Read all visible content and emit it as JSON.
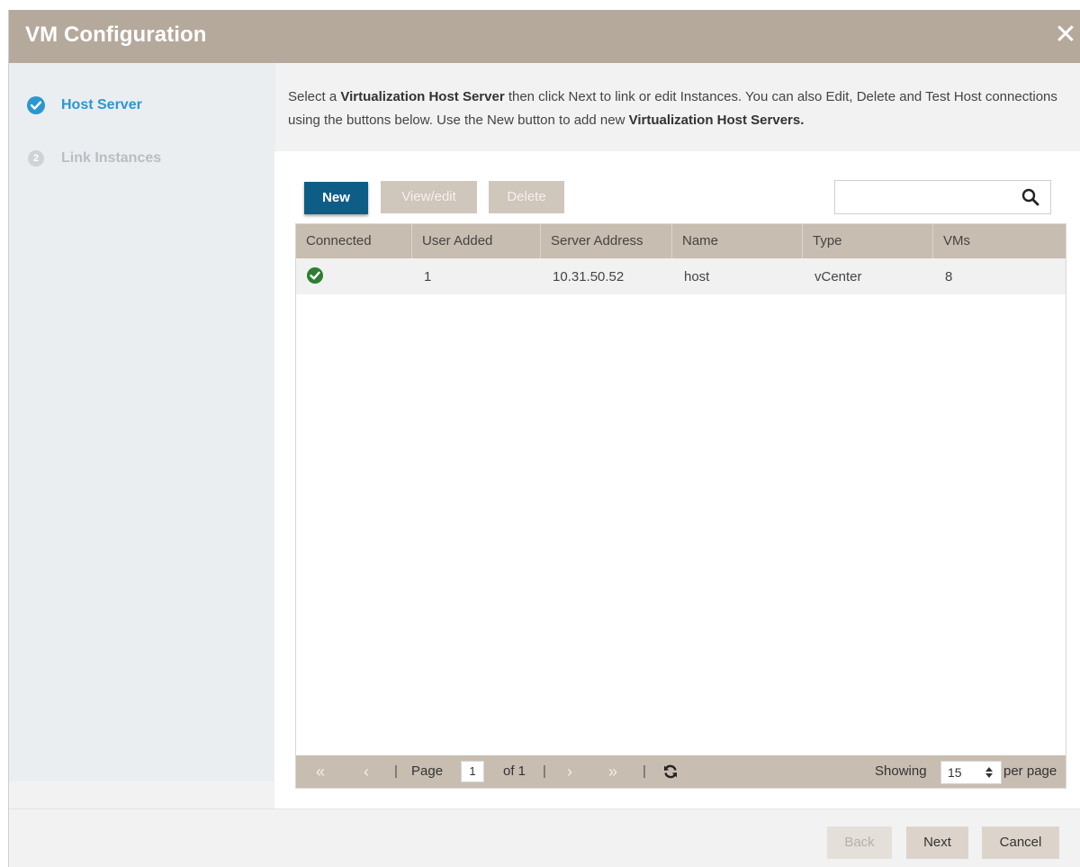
{
  "dialog": {
    "title": "VM Configuration",
    "close_glyph": "✕"
  },
  "steps": [
    {
      "number": "1",
      "label": "Host Server",
      "state": "done"
    },
    {
      "number": "2",
      "label": "Link Instances",
      "state": "disabled"
    }
  ],
  "intro": {
    "part1": "Select a ",
    "bold1": "Virtualization Host Server",
    "part2": " then click Next to link or edit Instances. You can also Edit, Delete and Test Host connections using the buttons below. Use the New button to add new ",
    "bold2": "Virtualization Host Servers."
  },
  "toolbar": {
    "new_label": "New",
    "view_label": "View/edit",
    "delete_label": "Delete",
    "search_value": ""
  },
  "table": {
    "columns": [
      "Connected",
      "User Added",
      "Server Address",
      "Name",
      "Type",
      "VMs"
    ],
    "rows": [
      {
        "connected": "check-circle-icon",
        "user_added": "1",
        "server_address": "10.31.50.52",
        "name": "host",
        "type": "vCenter",
        "vms": "8"
      }
    ]
  },
  "pager": {
    "first": "«",
    "prev": "‹",
    "sep": "|",
    "page_label": "Page",
    "page_value": "1",
    "of_label": "of 1",
    "next": "›",
    "last": "»",
    "showing_label": "Showing",
    "per_page_value": "15",
    "per_page_label": "per page"
  },
  "footer": {
    "back_label": "Back",
    "next_label": "Next",
    "cancel_label": "Cancel"
  },
  "colors": {
    "titlebar": "#b5a99c",
    "primary_button": "#0e5d87",
    "step_active": "#2a98cf",
    "connected_ok": "#2e7d32"
  }
}
